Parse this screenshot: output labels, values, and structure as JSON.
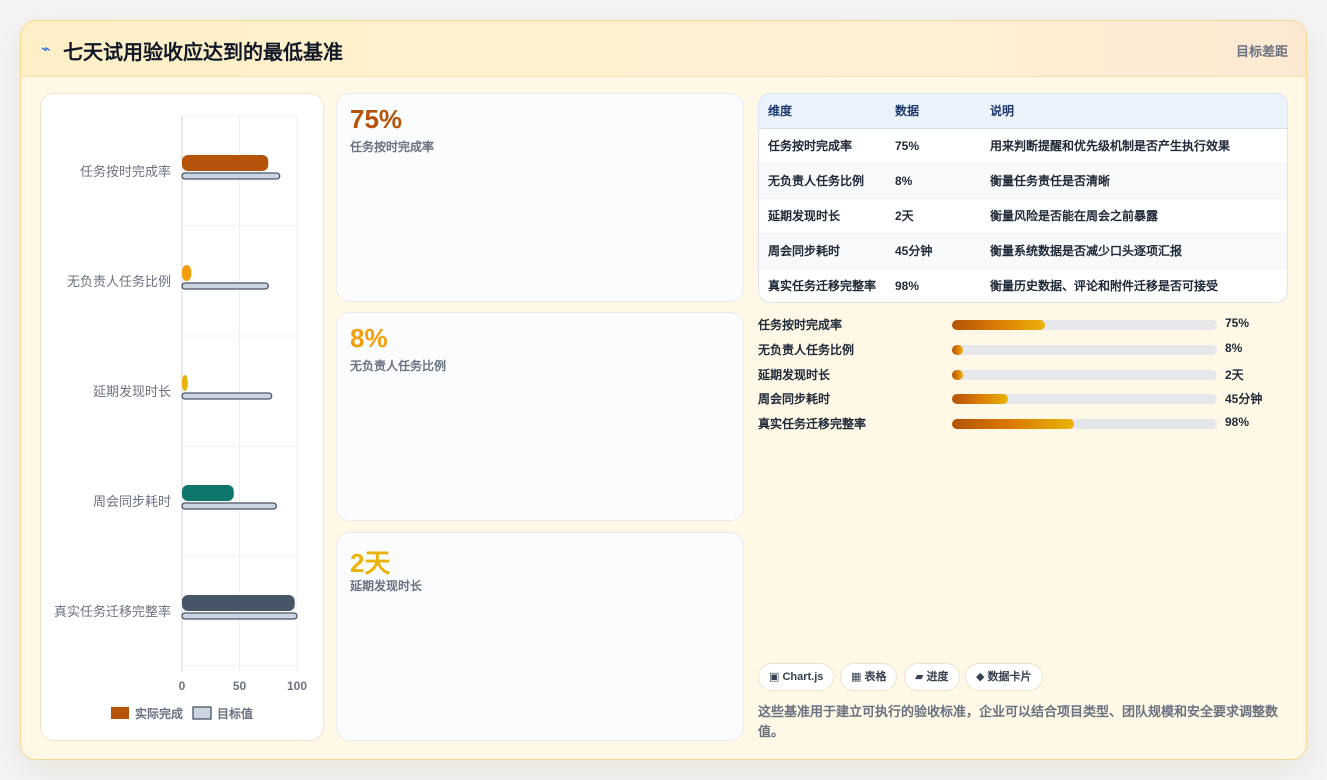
{
  "header": {
    "icon": "bolt-icon",
    "title": "七天试用验收应达到的最低基准",
    "right_label": "目标差距"
  },
  "chart_data": {
    "type": "bar",
    "orientation": "horizontal",
    "categories": [
      "任务按时完成率",
      "无负责人任务比例",
      "延期发现时长",
      "周会同步耗时",
      "真实任务迁移完整率"
    ],
    "series": [
      {
        "name": "实际完成",
        "values": [
          75,
          8,
          5,
          45,
          98
        ],
        "colors": [
          "#b45309",
          "#f59e0b",
          "#eab308",
          "#0f766e",
          "#475569"
        ]
      },
      {
        "name": "目标值",
        "values": [
          85,
          75,
          78,
          82,
          100
        ],
        "color": "#cbd5e1"
      }
    ],
    "xlim": [
      0,
      100
    ],
    "xticks": [
      "0",
      "50",
      "100"
    ],
    "grid": true,
    "legend": "bottom",
    "title": "",
    "xlabel": "",
    "ylabel": ""
  },
  "kpis": [
    {
      "value": "75%",
      "label": "任务按时完成率",
      "color": "#b45309"
    },
    {
      "value": "8%",
      "label": "无负责人任务比例",
      "color": "#f59e0b"
    },
    {
      "value": "2天",
      "label": "延期发现时长",
      "color": "#eab308"
    }
  ],
  "table": {
    "headers": [
      "维度",
      "数据",
      "说明"
    ],
    "rows": [
      [
        "任务按时完成率",
        "75%",
        "用来判断提醒和优先级机制是否产生执行效果"
      ],
      [
        "无负责人任务比例",
        "8%",
        "衡量任务责任是否清晰"
      ],
      [
        "延期发现时长",
        "2天",
        "衡量风险是否能在周会之前暴露"
      ],
      [
        "周会同步耗时",
        "45分钟",
        "衡量系统数据是否减少口头逐项汇报"
      ],
      [
        "真实任务迁移完整率",
        "98%",
        "衡量历史数据、评论和附件迁移是否可接受"
      ]
    ]
  },
  "progress": [
    {
      "label": "任务按时完成率",
      "value": "75%",
      "fraction": 0.35
    },
    {
      "label": "无负责人任务比例",
      "value": "8%",
      "fraction": 0.04
    },
    {
      "label": "延期发现时长",
      "value": "2天",
      "fraction": 0.04
    },
    {
      "label": "周会同步耗时",
      "value": "45分钟",
      "fraction": 0.21
    },
    {
      "label": "真实任务迁移完整率",
      "value": "98%",
      "fraction": 0.46
    }
  ],
  "chips": [
    {
      "icon": "chart-icon",
      "text": "▣ Chart.js"
    },
    {
      "icon": "table-icon",
      "text": "▦ 表格"
    },
    {
      "icon": "progress-icon",
      "text": "▰ 进度"
    },
    {
      "icon": "diamond-icon",
      "text": "◆ 数据卡片"
    }
  ],
  "note": "这些基准用于建立可执行的验收标准，企业可以结合项目类型、团队规模和安全要求调整数值。"
}
